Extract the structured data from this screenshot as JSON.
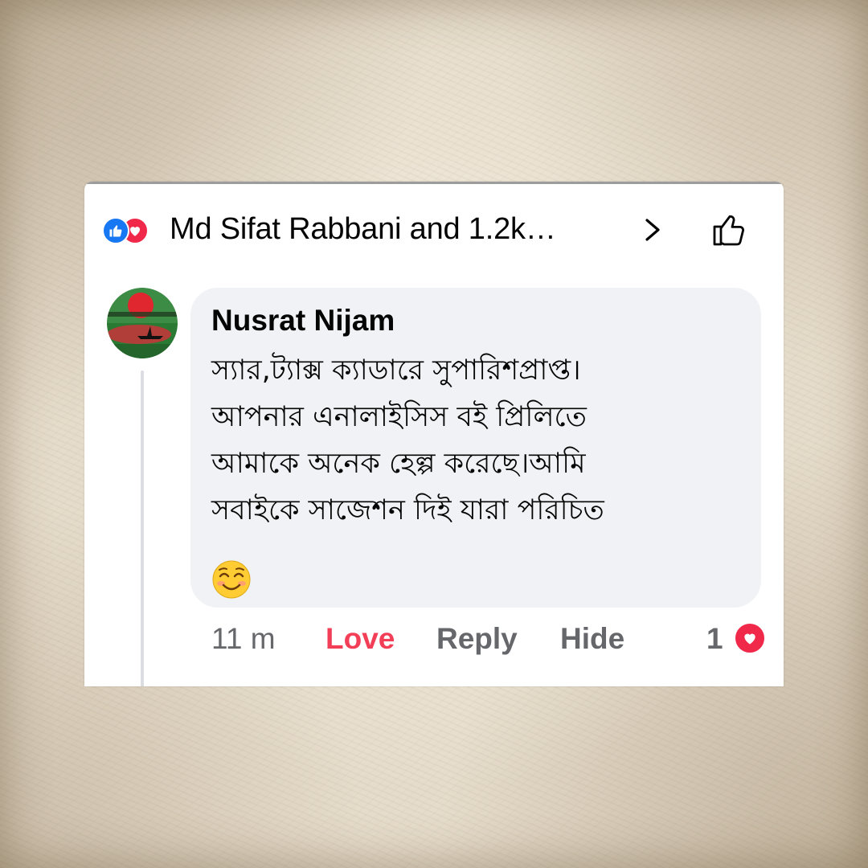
{
  "header": {
    "reactors": "Md Sifat Rabbani and 1.2k…",
    "reaction_icons": [
      "like-icon",
      "love-icon"
    ],
    "chevron_icon": "chevron-right-icon",
    "like_button_icon": "thumbs-up-outline-icon"
  },
  "comment": {
    "author": "Nusrat Nijam",
    "lines": [
      "স্যার,ট্যাক্স ক্যাডারে সুপারিশপ্রাপ্ত।",
      "আপনার এনালাইসিস বই প্রিলিতে",
      "আমাকে অনেক হেল্প করেছে।আমি",
      "সবাইকে সাজেশন দিই যারা পরিচিত"
    ],
    "emoji": "smiling-face-icon",
    "time": "11 m",
    "actions": {
      "love": "Love",
      "reply": "Reply",
      "hide": "Hide"
    },
    "reaction_count": "1"
  },
  "colors": {
    "like_blue": "#1877f2",
    "love_red": "#f02849",
    "love_text": "#f33e58",
    "bubble_bg": "#f0f2f5",
    "secondary_text": "#65676b"
  }
}
